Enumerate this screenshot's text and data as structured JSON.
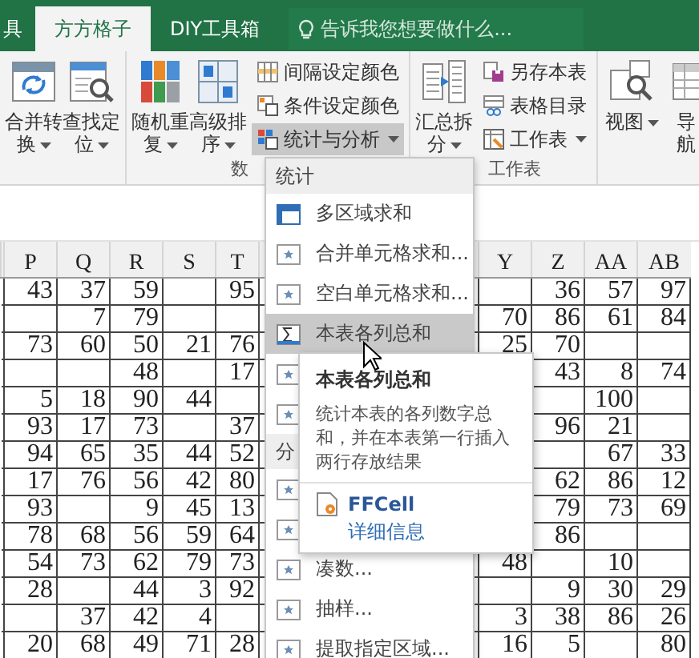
{
  "tabs": [
    {
      "label": "具",
      "selected": false
    },
    {
      "label": "方方格子",
      "selected": true
    },
    {
      "label": "DIY工具箱",
      "selected": false
    }
  ],
  "tell_me": {
    "placeholder": "告诉我您想要做什么..."
  },
  "ribbon": {
    "groups": [
      {
        "items": [
          {
            "kind": "large",
            "label": "合并转换",
            "dropdown": true
          },
          {
            "kind": "large",
            "label": "查找定位",
            "dropdown": true
          }
        ]
      },
      {
        "label": "数",
        "items": [
          {
            "kind": "large",
            "label": "随机重复",
            "dropdown": true
          },
          {
            "kind": "large",
            "label": "高级排序",
            "dropdown": true
          },
          {
            "kind": "stack",
            "buttons": [
              {
                "label": "间隔设定颜色",
                "dropdown": false,
                "pressed": false
              },
              {
                "label": "条件设定颜色",
                "dropdown": false,
                "pressed": false
              },
              {
                "label": "统计与分析",
                "dropdown": true,
                "pressed": true
              }
            ]
          }
        ]
      },
      {
        "label": "工作表",
        "items": [
          {
            "kind": "large",
            "label": "汇总拆分",
            "dropdown": true
          },
          {
            "kind": "stack",
            "buttons": [
              {
                "label": "另存本表",
                "dropdown": false,
                "pressed": false
              },
              {
                "label": "表格目录",
                "dropdown": false,
                "pressed": false
              },
              {
                "label": "工作表",
                "dropdown": true,
                "pressed": false
              }
            ]
          }
        ]
      },
      {
        "items": [
          {
            "kind": "large",
            "label": "视图",
            "dropdown": true
          },
          {
            "kind": "large",
            "label": "导航",
            "dropdown": false
          }
        ]
      }
    ]
  },
  "table": {
    "columns": [
      "P",
      "Q",
      "R",
      "S",
      "T",
      "Y",
      "Z",
      "AA",
      "AB"
    ],
    "rows": [
      [
        "43",
        "37",
        "59",
        null,
        "95",
        null,
        "36",
        "57",
        "97"
      ],
      [
        null,
        "7",
        "79",
        null,
        null,
        "70",
        "86",
        "61",
        "84"
      ],
      [
        "73",
        "60",
        "50",
        "21",
        "76",
        "25",
        "70",
        null,
        null
      ],
      [
        null,
        null,
        "48",
        null,
        "17",
        null,
        "43",
        "8",
        "74"
      ],
      [
        "5",
        "18",
        "90",
        "44",
        null,
        null,
        null,
        "100",
        null
      ],
      [
        "93",
        "17",
        "73",
        null,
        "37",
        null,
        "96",
        "21",
        null
      ],
      [
        "94",
        "65",
        "35",
        "44",
        "52",
        null,
        null,
        "67",
        "33"
      ],
      [
        "17",
        "76",
        "56",
        "42",
        "80",
        null,
        "62",
        "86",
        "12"
      ],
      [
        "93",
        null,
        "9",
        "45",
        "13",
        null,
        "79",
        "73",
        "69"
      ],
      [
        "78",
        "68",
        "56",
        "59",
        "64",
        null,
        "86",
        null,
        null
      ],
      [
        "54",
        "73",
        "62",
        "79",
        "73",
        "48",
        null,
        "10",
        null
      ],
      [
        "28",
        null,
        "44",
        "3",
        "92",
        null,
        "9",
        "30",
        "29"
      ],
      [
        null,
        "37",
        "42",
        "4",
        null,
        "3",
        "38",
        "86",
        "26"
      ],
      [
        "20",
        "68",
        "49",
        "71",
        "28",
        "16",
        "5",
        null,
        "80"
      ]
    ]
  },
  "menu": {
    "items": [
      {
        "kind": "header",
        "label": "统计"
      },
      {
        "kind": "item",
        "label": "多区域求和",
        "selected": false
      },
      {
        "kind": "item",
        "label": "合并单元格求和...",
        "selected": false
      },
      {
        "kind": "item",
        "label": "空白单元格求和...",
        "selected": false
      },
      {
        "kind": "item",
        "label": "本表各列总和",
        "selected": true
      },
      {
        "kind": "item",
        "selected": false
      },
      {
        "kind": "item",
        "selected": false
      },
      {
        "kind": "header",
        "label": "分"
      },
      {
        "kind": "item",
        "selected": false
      },
      {
        "kind": "item",
        "selected": false
      },
      {
        "kind": "item",
        "label": "凑数...",
        "selected": false
      },
      {
        "kind": "item",
        "label": "抽样...",
        "selected": false
      },
      {
        "kind": "item",
        "label": "提取指定区域...",
        "selected": false
      }
    ]
  },
  "tooltip": {
    "title": "本表各列总和",
    "description": "统计本表的各列数字总和，并在本表第一行插入两行存放结果",
    "addin": "FFCell",
    "link": "详细信息"
  }
}
